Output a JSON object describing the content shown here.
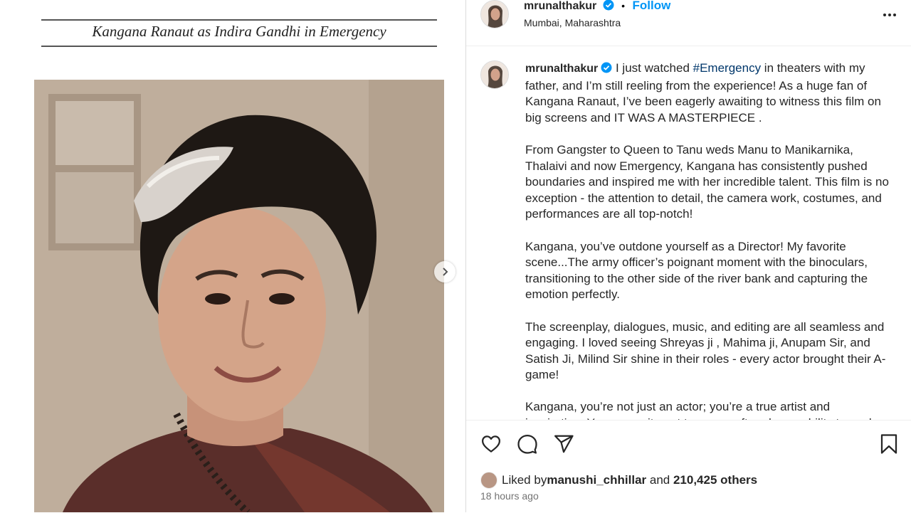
{
  "media": {
    "caption": "Kangana Ranaut as Indira Gandhi in Emergency",
    "next_icon": "chevron-right-icon"
  },
  "header": {
    "username": "mrunalthakur",
    "separator": "•",
    "follow_label": "Follow",
    "location": "Mumbai, Maharashtra",
    "more_icon": "more-horizontal-icon"
  },
  "caption": {
    "username": "mrunalthakur",
    "p1_before": " I just watched ",
    "hashtag": "#Emergency",
    "p1_after": " in theaters with my father, and I’m still reeling from the experience! As a huge fan of Kangana Ranaut, I’ve been eagerly awaiting to witness this film on big screens and IT WAS A MASTERPIECE .",
    "p2": "From Gangster to Queen to Tanu weds Manu to Manikarnika, Thalaivi and now Emergency, Kangana has consistently pushed boundaries and inspired me with her incredible talent. This film is no exception - the attention to detail, the camera work, costumes, and performances are all top-notch!",
    "p3": "Kangana, you’ve outdone yourself as a Director! My favorite scene...The army officer’s poignant moment with the binoculars, transitioning to the other side of the river bank and capturing the emotion perfectly.",
    "p4": "The screenplay, dialogues, music, and editing are all seamless and engaging. I loved seeing Shreyas ji , Mahima ji, Anupam Sir, and Satish Ji, Milind Sir shine in their roles - every actor brought their A-game!",
    "p5": "Kangana, you’re not just an actor; you’re a true artist and inspiration. Your commitment to your craft and your ability to evoke"
  },
  "actions": {
    "like_icon": "heart-icon",
    "comment_icon": "comment-icon",
    "share_icon": "share-icon",
    "save_icon": "bookmark-icon"
  },
  "likes": {
    "prefix": "Liked by ",
    "user": "manushi_chhillar",
    "middle": " and ",
    "count": "210,425 others"
  },
  "timestamp": "18 hours ago",
  "colors": {
    "accent": "#0095f6",
    "verified": "#0095f6",
    "hashtag": "#00376b"
  }
}
